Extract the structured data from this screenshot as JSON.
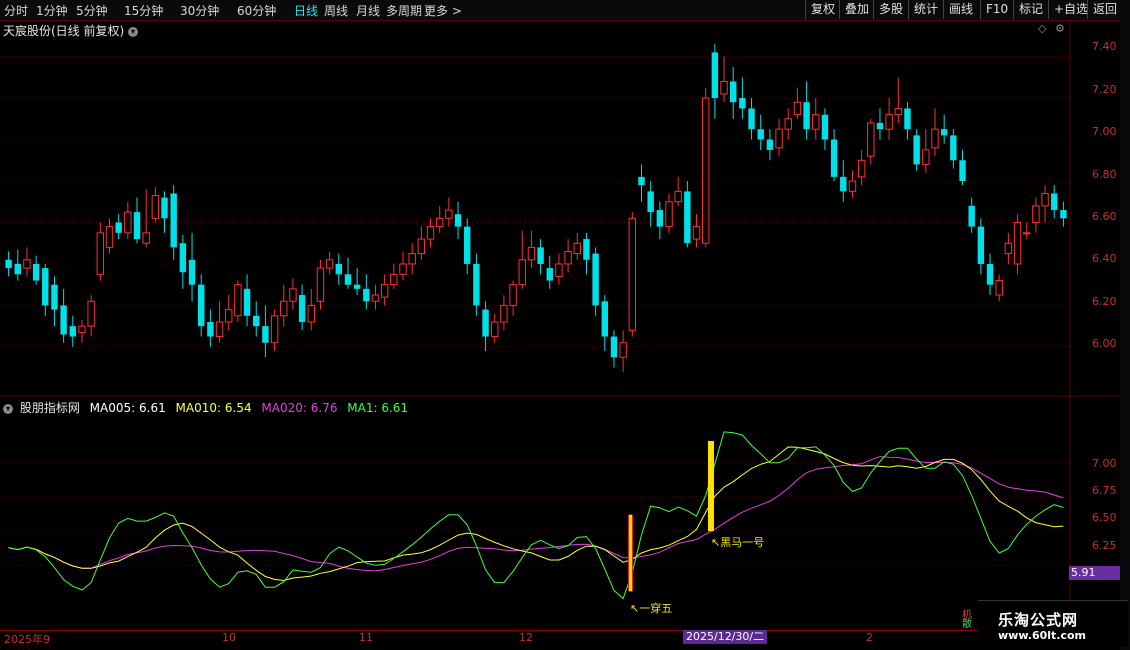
{
  "toolbar": {
    "periods": [
      "分时",
      "1分钟",
      "5分钟",
      "15分钟",
      "30分钟",
      "60分钟",
      "日线",
      "周线",
      "月线",
      "多周期",
      "更多 >"
    ],
    "active_period": "日线",
    "right_buttons": [
      "复权",
      "叠加",
      "多股",
      "统计",
      "画线",
      "F10",
      "标记",
      "+自选",
      "返回"
    ]
  },
  "stock": {
    "title": "天宸股份(日线 前复权)"
  },
  "price_axis": [
    "7.40",
    "7.20",
    "7.00",
    "6.80",
    "6.60",
    "6.40",
    "6.20",
    "6.00"
  ],
  "indicator": {
    "name": "股朋指标网",
    "ma005": "MA005: 6.61",
    "ma010": "MA010: 6.54",
    "ma020": "MA020: 6.76",
    "ma1": "MA1: 6.61",
    "axis": [
      "7.00",
      "6.75",
      "6.50",
      "6.25"
    ],
    "last_value": "5.91",
    "annotations": {
      "dark_horse": "↖黑马一号",
      "one_pierce": "↖一穿五"
    }
  },
  "dates": {
    "labels": [
      "2025年9",
      "10",
      "11",
      "12",
      "2"
    ],
    "highlight": "2025/12/30/二"
  },
  "watermark": {
    "name": "乐淘公式网",
    "url": "www.60lt.com"
  },
  "side_legend": {
    "red": "机",
    "green": "散"
  },
  "colors": {
    "up": "#ff3030",
    "down": "#00e0e8",
    "ma5": "#ffffff",
    "ma10": "#ffff40",
    "ma20": "#e040e0",
    "ma1": "#40ff40",
    "grid": "#5a0000"
  },
  "chart_data": {
    "type": "candlestick",
    "ylim_price": [
      5.85,
      7.48
    ],
    "ylim_indicator": [
      5.85,
      7.35
    ],
    "candles": [
      [
        6.42,
        6.38,
        6.46,
        6.34
      ],
      [
        6.4,
        6.35,
        6.47,
        6.32
      ],
      [
        6.38,
        6.42,
        6.48,
        6.34
      ],
      [
        6.4,
        6.32,
        6.44,
        6.3
      ],
      [
        6.38,
        6.2,
        6.4,
        6.15
      ],
      [
        6.3,
        6.18,
        6.34,
        6.1
      ],
      [
        6.2,
        6.06,
        6.28,
        6.02
      ],
      [
        6.1,
        6.05,
        6.15,
        6.0
      ],
      [
        6.07,
        6.1,
        6.13,
        6.02
      ],
      [
        6.1,
        6.22,
        6.25,
        6.05
      ],
      [
        6.35,
        6.55,
        6.6,
        6.32
      ],
      [
        6.48,
        6.58,
        6.62,
        6.45
      ],
      [
        6.6,
        6.55,
        6.64,
        6.52
      ],
      [
        6.55,
        6.65,
        6.7,
        6.52
      ],
      [
        6.65,
        6.52,
        6.72,
        6.5
      ],
      [
        6.5,
        6.55,
        6.76,
        6.48
      ],
      [
        6.62,
        6.73,
        6.77,
        6.6
      ],
      [
        6.72,
        6.62,
        6.75,
        6.55
      ],
      [
        6.74,
        6.48,
        6.78,
        6.42
      ],
      [
        6.5,
        6.36,
        6.54,
        6.28
      ],
      [
        6.42,
        6.3,
        6.55,
        6.22
      ],
      [
        6.3,
        6.1,
        6.35,
        6.05
      ],
      [
        6.12,
        6.05,
        6.18,
        6.0
      ],
      [
        6.05,
        6.12,
        6.22,
        6.02
      ],
      [
        6.12,
        6.18,
        6.25,
        6.08
      ],
      [
        6.15,
        6.3,
        6.32,
        6.12
      ],
      [
        6.28,
        6.15,
        6.35,
        6.1
      ],
      [
        6.15,
        6.1,
        6.22,
        6.05
      ],
      [
        6.1,
        6.02,
        6.2,
        5.95
      ],
      [
        6.02,
        6.15,
        6.18,
        5.98
      ],
      [
        6.15,
        6.22,
        6.3,
        6.1
      ],
      [
        6.22,
        6.28,
        6.33,
        6.18
      ],
      [
        6.25,
        6.12,
        6.3,
        6.08
      ],
      [
        6.12,
        6.2,
        6.28,
        6.08
      ],
      [
        6.22,
        6.38,
        6.42,
        6.18
      ],
      [
        6.38,
        6.42,
        6.46,
        6.35
      ],
      [
        6.4,
        6.35,
        6.45,
        6.3
      ],
      [
        6.35,
        6.3,
        6.43,
        6.28
      ],
      [
        6.3,
        6.28,
        6.38,
        6.25
      ],
      [
        6.28,
        6.22,
        6.35,
        6.18
      ],
      [
        6.22,
        6.25,
        6.3,
        6.18
      ],
      [
        6.24,
        6.3,
        6.35,
        6.2
      ],
      [
        6.3,
        6.35,
        6.4,
        6.28
      ],
      [
        6.35,
        6.4,
        6.46,
        6.32
      ],
      [
        6.4,
        6.45,
        6.5,
        6.35
      ],
      [
        6.45,
        6.52,
        6.58,
        6.42
      ],
      [
        6.52,
        6.58,
        6.62,
        6.48
      ],
      [
        6.58,
        6.62,
        6.68,
        6.55
      ],
      [
        6.62,
        6.66,
        6.72,
        6.58
      ],
      [
        6.64,
        6.58,
        6.7,
        6.52
      ],
      [
        6.58,
        6.4,
        6.62,
        6.35
      ],
      [
        6.4,
        6.2,
        6.45,
        6.15
      ],
      [
        6.18,
        6.05,
        6.22,
        5.98
      ],
      [
        6.05,
        6.12,
        6.16,
        6.02
      ],
      [
        6.12,
        6.2,
        6.25,
        6.08
      ],
      [
        6.2,
        6.3,
        6.32,
        6.15
      ],
      [
        6.3,
        6.42,
        6.56,
        6.28
      ],
      [
        6.42,
        6.48,
        6.56,
        6.38
      ],
      [
        6.48,
        6.4,
        6.52,
        6.35
      ],
      [
        6.38,
        6.32,
        6.44,
        6.28
      ],
      [
        6.34,
        6.4,
        6.45,
        6.3
      ],
      [
        6.4,
        6.46,
        6.52,
        6.36
      ],
      [
        6.45,
        6.5,
        6.55,
        6.42
      ],
      [
        6.52,
        6.42,
        6.55,
        6.35
      ],
      [
        6.45,
        6.2,
        6.48,
        6.15
      ],
      [
        6.22,
        6.05,
        6.25,
        5.98
      ],
      [
        6.05,
        5.95,
        6.08,
        5.9
      ],
      [
        5.95,
        6.02,
        6.08,
        5.88
      ],
      [
        6.08,
        6.62,
        6.65,
        6.05
      ],
      [
        6.82,
        6.78,
        6.88,
        6.7
      ],
      [
        6.75,
        6.65,
        6.8,
        6.58
      ],
      [
        6.66,
        6.58,
        6.7,
        6.52
      ],
      [
        6.58,
        6.7,
        6.74,
        6.55
      ],
      [
        6.7,
        6.75,
        6.82,
        6.68
      ],
      [
        6.75,
        6.5,
        6.8,
        6.48
      ],
      [
        6.52,
        6.58,
        6.64,
        6.48
      ],
      [
        6.5,
        7.2,
        7.25,
        6.48
      ],
      [
        7.42,
        7.2,
        7.46,
        7.1
      ],
      [
        7.22,
        7.28,
        7.4,
        7.18
      ],
      [
        7.28,
        7.18,
        7.35,
        7.1
      ],
      [
        7.2,
        7.15,
        7.3,
        7.1
      ],
      [
        7.15,
        7.05,
        7.2,
        7.0
      ],
      [
        7.05,
        7.0,
        7.12,
        6.95
      ],
      [
        7.0,
        6.95,
        7.05,
        6.9
      ],
      [
        6.96,
        7.05,
        7.1,
        6.92
      ],
      [
        7.05,
        7.1,
        7.15,
        7.0
      ],
      [
        7.12,
        7.18,
        7.25,
        7.1
      ],
      [
        7.18,
        7.05,
        7.28,
        7.0
      ],
      [
        7.05,
        7.12,
        7.2,
        7.0
      ],
      [
        7.12,
        7.0,
        7.15,
        6.95
      ],
      [
        7.0,
        6.82,
        7.05,
        6.8
      ],
      [
        6.82,
        6.75,
        6.9,
        6.7
      ],
      [
        6.75,
        6.8,
        6.85,
        6.72
      ],
      [
        6.82,
        6.9,
        6.95,
        6.78
      ],
      [
        6.92,
        7.08,
        7.1,
        6.88
      ],
      [
        7.08,
        7.05,
        7.15,
        7.0
      ],
      [
        7.05,
        7.12,
        7.2,
        7.0
      ],
      [
        7.12,
        7.15,
        7.3,
        7.08
      ],
      [
        7.15,
        7.05,
        7.18,
        7.0
      ],
      [
        7.02,
        6.88,
        7.05,
        6.85
      ],
      [
        6.88,
        6.95,
        7.05,
        6.84
      ],
      [
        6.96,
        7.05,
        7.15,
        6.92
      ],
      [
        7.05,
        7.02,
        7.12,
        6.98
      ],
      [
        7.02,
        6.9,
        7.05,
        6.86
      ],
      [
        6.9,
        6.8,
        6.95,
        6.78
      ],
      [
        6.68,
        6.58,
        6.72,
        6.55
      ],
      [
        6.58,
        6.4,
        6.62,
        6.35
      ],
      [
        6.4,
        6.3,
        6.45,
        6.25
      ],
      [
        6.25,
        6.32,
        6.35,
        6.22
      ],
      [
        6.45,
        6.5,
        6.55,
        6.4
      ],
      [
        6.4,
        6.6,
        6.64,
        6.35
      ],
      [
        6.55,
        6.55,
        6.6,
        6.52
      ],
      [
        6.6,
        6.68,
        6.72,
        6.55
      ],
      [
        6.68,
        6.74,
        6.78,
        6.6
      ],
      [
        6.74,
        6.66,
        6.78,
        6.62
      ],
      [
        6.66,
        6.62,
        6.7,
        6.58
      ]
    ]
  }
}
